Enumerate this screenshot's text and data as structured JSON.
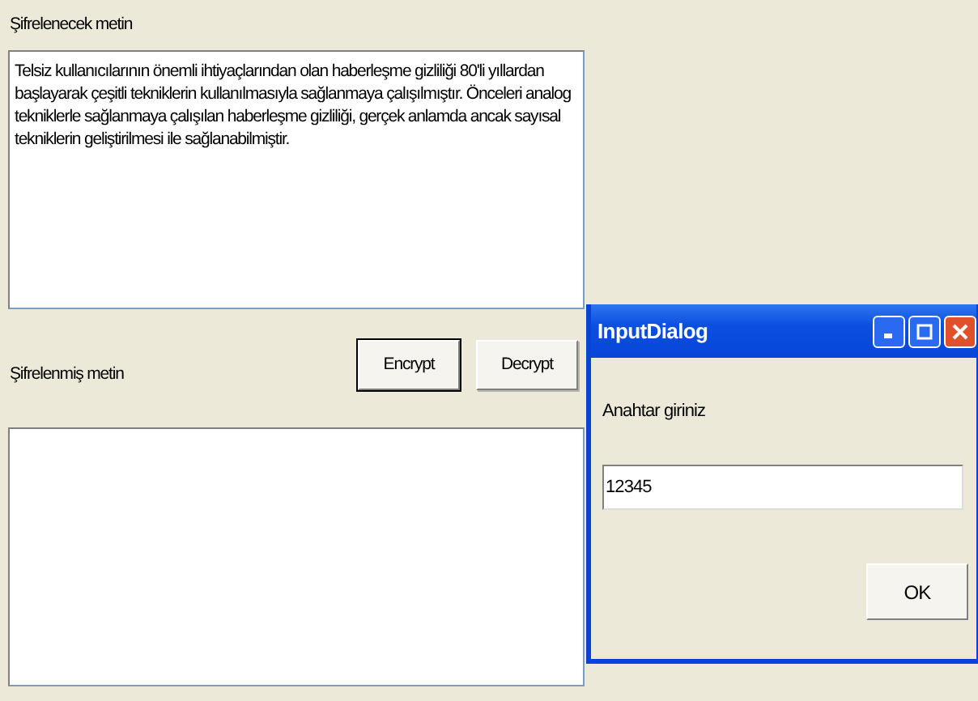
{
  "form": {
    "source_label": "Şifrelenecek metin",
    "source_text": "Telsiz kullanıcılarının önemli ihtiyaçlarından olan haberleşme gizliliği 80'li yıllardan başlayarak çeşitli tekniklerin kullanılmasıyla sağlanmaya çalışılmıştır. Önceleri analog tekniklerle sağlanmaya çalışılan haberleşme gizliliği, gerçek anlamda ancak sayısal tekniklerin geliştirilmesi ile sağlanabilmiştir.",
    "buttons": [
      {
        "label": "Encrypt",
        "focused": true
      },
      {
        "label": "Decrypt",
        "focused": false
      }
    ],
    "result_label": "Şifrelenmiş metin"
  },
  "dialog": {
    "title": "InputDialog",
    "prompt": "Anahtar giriniz",
    "value": "12345",
    "button": "OK"
  }
}
